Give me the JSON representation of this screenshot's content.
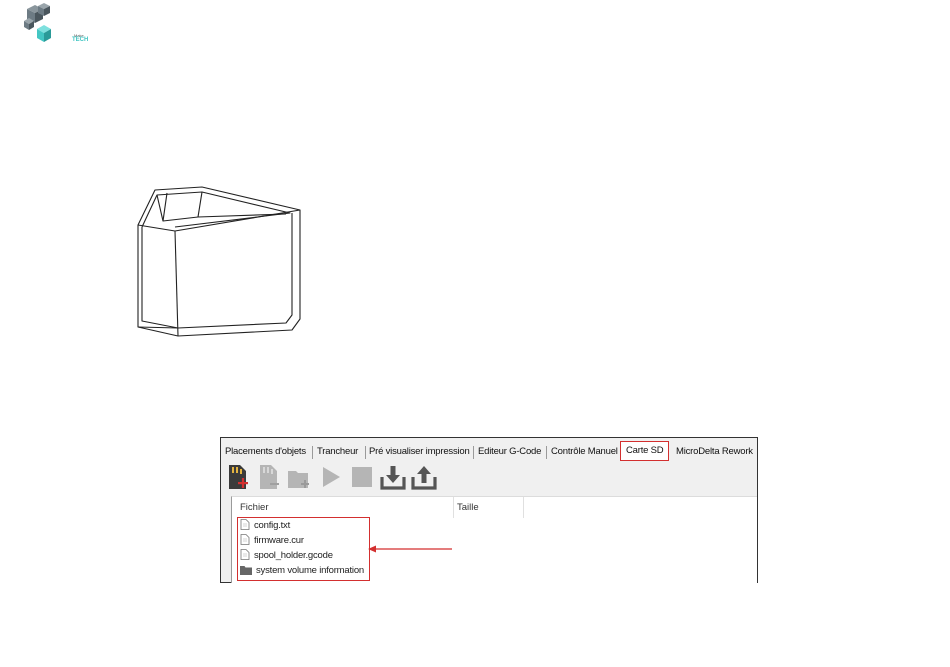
{
  "logo": {
    "line1": "Make",
    "line2": "TECH"
  },
  "window": {
    "tabs": [
      {
        "label": "Placements d'objets",
        "active": false
      },
      {
        "label": "Trancheur",
        "active": false
      },
      {
        "label": "Pré visualiser impression",
        "active": false
      },
      {
        "label": "Editeur G-Code",
        "active": false
      },
      {
        "label": "Contrôle Manuel",
        "active": false
      },
      {
        "label": "Carte SD",
        "active": true
      },
      {
        "label": "MicroDelta Rework",
        "active": false
      }
    ],
    "toolbar": [
      {
        "icon": "sd-card-add-icon",
        "enabled": true
      },
      {
        "icon": "sd-card-remove-icon",
        "enabled": false
      },
      {
        "icon": "new-folder-icon",
        "enabled": false
      },
      {
        "icon": "play-icon",
        "enabled": false
      },
      {
        "icon": "stop-icon",
        "enabled": false
      },
      {
        "icon": "download-icon",
        "enabled": true
      },
      {
        "icon": "upload-icon",
        "enabled": true
      }
    ],
    "columns": {
      "name": "Fichier",
      "size": "Taille"
    },
    "files": [
      {
        "name": "config.txt",
        "type": "file"
      },
      {
        "name": "firmware.cur",
        "type": "file"
      },
      {
        "name": "spool_holder.gcode",
        "type": "file"
      },
      {
        "name": "system volume information",
        "type": "folder"
      }
    ]
  },
  "colors": {
    "accent": "#d32f2f",
    "logo_teal": "#43c6c3",
    "logo_gray": "#6d7b84"
  }
}
